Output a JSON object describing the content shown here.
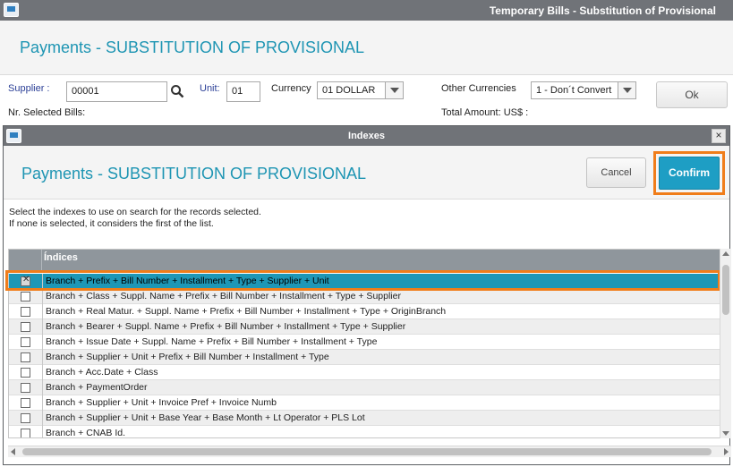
{
  "window": {
    "title": "Temporary Bills - Substitution of Provisional"
  },
  "page": {
    "heading": "Payments - SUBSTITUTION OF PROVISIONAL"
  },
  "form": {
    "supplier_label": "Supplier :",
    "supplier_value": "00001",
    "unit_label": "Unit:",
    "unit_value": "01",
    "currency_label": "Currency",
    "currency_value": "01 DOLLAR",
    "other_currencies_label": "Other Currencies",
    "other_currencies_value": "1 - Don´t Convert",
    "ok_label": "Ok",
    "selected_bills_label": "Nr. Selected Bills:",
    "total_amount_label": "Total Amount: US$ :"
  },
  "dialog": {
    "title": "Indexes",
    "heading": "Payments - SUBSTITUTION OF PROVISIONAL",
    "cancel_label": "Cancel",
    "confirm_label": "Confirm",
    "instruction_1": "Select the indexes to use on search for the records selected.",
    "instruction_2": "If none is selected, it considers the first of the list.",
    "grid": {
      "column_header": "Índices",
      "rows": [
        {
          "label": "Branch + Prefix + Bill Number + Installment + Type + Supplier + Unit",
          "checked": true
        },
        {
          "label": "Branch + Class + Suppl. Name + Prefix + Bill Number + Installment + Type + Supplier",
          "checked": false
        },
        {
          "label": "Branch + Real Matur. + Suppl. Name + Prefix + Bill Number + Installment + Type + OriginBranch",
          "checked": false
        },
        {
          "label": "Branch + Bearer + Suppl. Name + Prefix + Bill Number + Installment + Type + Supplier",
          "checked": false
        },
        {
          "label": "Branch + Issue Date + Suppl. Name + Prefix + Bill Number + Installment + Type",
          "checked": false
        },
        {
          "label": "Branch + Supplier + Unit + Prefix + Bill Number + Installment + Type",
          "checked": false
        },
        {
          "label": "Branch + Acc.Date + Class",
          "checked": false
        },
        {
          "label": "Branch + PaymentOrder",
          "checked": false
        },
        {
          "label": "Branch + Supplier + Unit + Invoice Pref + Invoice Numb",
          "checked": false
        },
        {
          "label": "Branch + Supplier + Unit + Base Year + Base Month + Lt Operator + PLS Lot",
          "checked": false
        },
        {
          "label": "Branch + CNAB Id.",
          "checked": false
        }
      ]
    }
  },
  "colors": {
    "accent": "#1e95b3",
    "highlight": "#f07d1a",
    "titlebar": "#707378",
    "confirm": "#1e9ec4"
  }
}
